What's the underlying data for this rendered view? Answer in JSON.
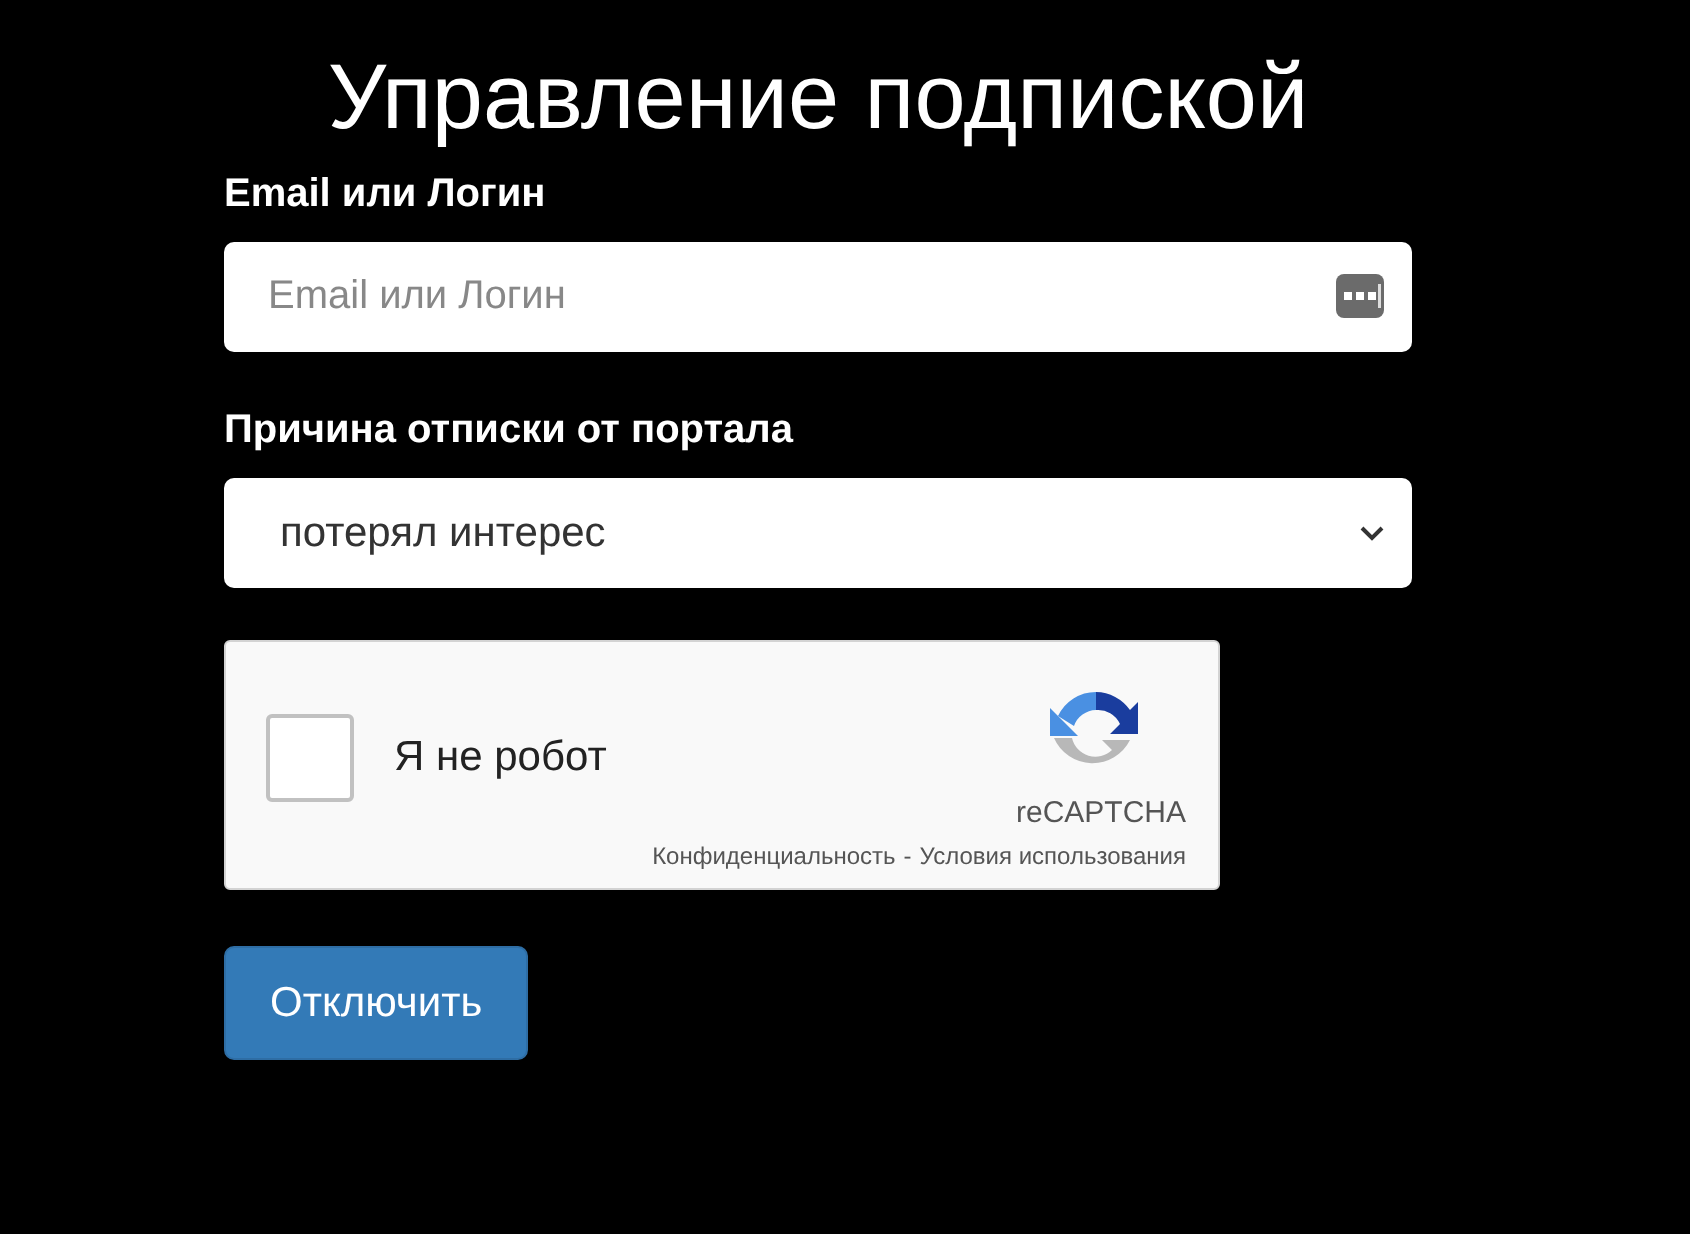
{
  "title": "Управление подпиской",
  "email": {
    "label": "Email или Логин",
    "placeholder": "Email или Логин"
  },
  "reason": {
    "label": "Причина отписки от портала",
    "value": "потерял интерес"
  },
  "captcha": {
    "label": "Я не робот",
    "checked": false,
    "brand": "reCAPTCHA",
    "links": [
      "Конфиденциальность",
      "Условия использования"
    ],
    "separator": "-"
  },
  "submit": "Отключить"
}
